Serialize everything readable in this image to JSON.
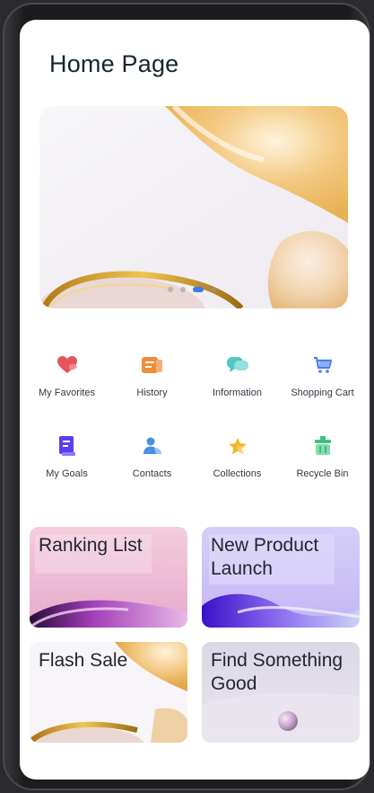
{
  "page": {
    "title": "Home Page"
  },
  "banner": {
    "dot_count": 4,
    "active_index": 2
  },
  "grid": [
    {
      "label": "My Favorites",
      "icon": "heart-icon",
      "color": "#e55a5a"
    },
    {
      "label": "History",
      "icon": "history-icon",
      "color": "#f08d3a"
    },
    {
      "label": "Information",
      "icon": "message-icon",
      "color": "#4fc7c5"
    },
    {
      "label": "Shopping Cart",
      "icon": "shopping-cart-icon",
      "color": "#4f7bf0"
    },
    {
      "label": "My Goals",
      "icon": "goals-icon",
      "color": "#6a4ff0"
    },
    {
      "label": "Contacts",
      "icon": "contacts-icon",
      "color": "#4a8fe6"
    },
    {
      "label": "Collections",
      "icon": "star-icon",
      "color": "#f2b81f"
    },
    {
      "label": "Recycle Bin",
      "icon": "recycle-bin-icon",
      "color": "#3fbf7f"
    }
  ],
  "cards": [
    {
      "title": "Ranking List"
    },
    {
      "title": "New Product Launch"
    },
    {
      "title": "Flash Sale"
    },
    {
      "title": "Find Something Good"
    }
  ]
}
